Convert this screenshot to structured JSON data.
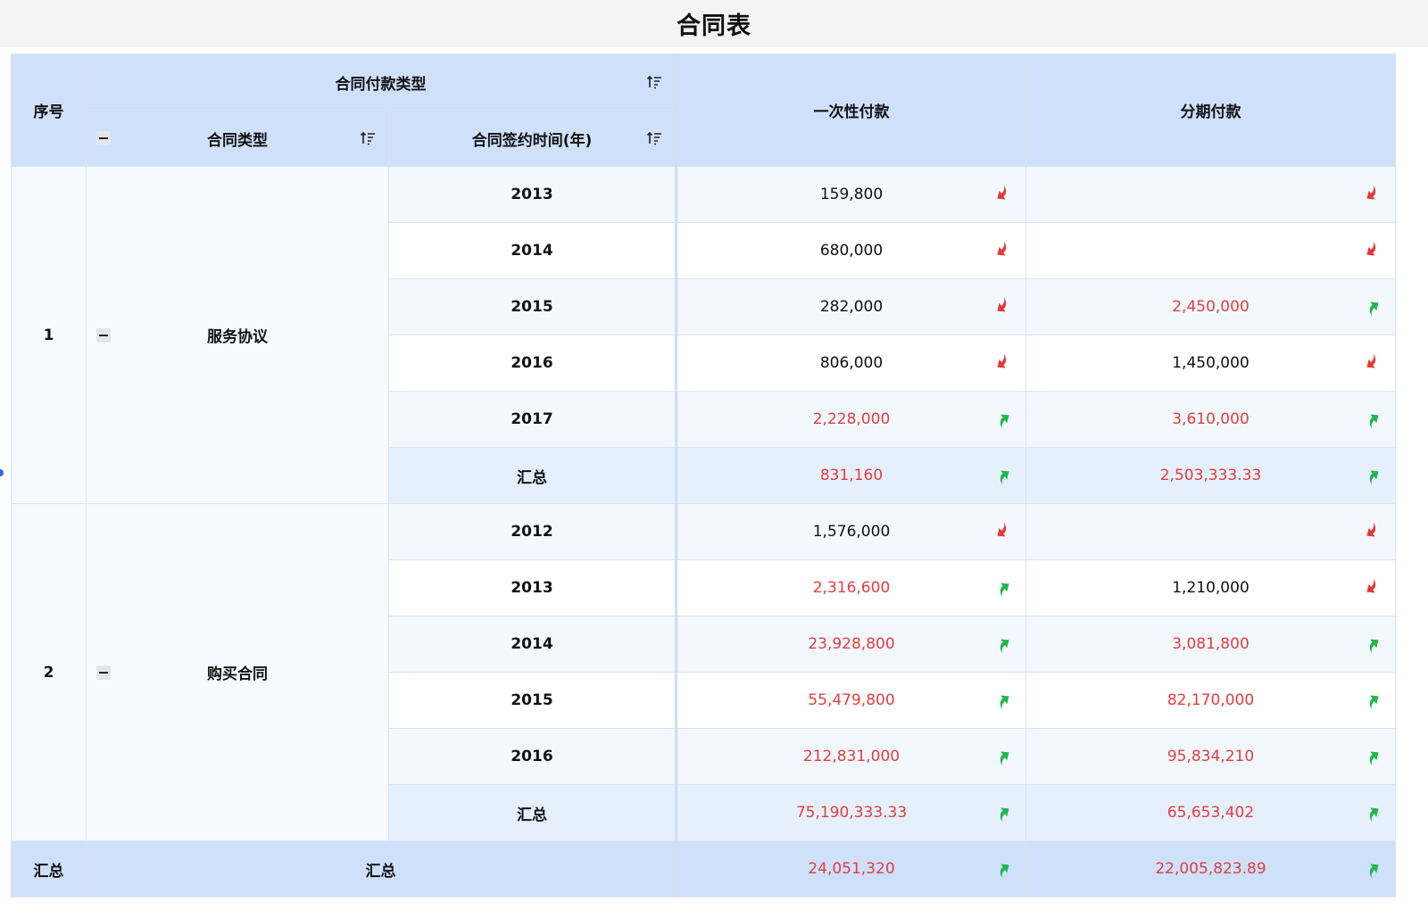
{
  "title": "合同表",
  "headers": {
    "index": "序号",
    "payment_type": "合同付款类型",
    "contract_type": "合同类型",
    "sign_year": "合同签约时间(年)",
    "lump_sum": "一次性付款",
    "installment": "分期付款"
  },
  "groups": [
    {
      "index": "1",
      "name": "服务协议",
      "rows": [
        {
          "year": "2013",
          "lump": "159,800",
          "lump_trend": "down",
          "inst": "",
          "inst_trend": "down"
        },
        {
          "year": "2014",
          "lump": "680,000",
          "lump_trend": "down",
          "inst": "",
          "inst_trend": "down"
        },
        {
          "year": "2015",
          "lump": "282,000",
          "lump_trend": "down",
          "inst": "2,450,000",
          "inst_trend": "up"
        },
        {
          "year": "2016",
          "lump": "806,000",
          "lump_trend": "down",
          "inst": "1,450,000",
          "inst_trend": "down"
        },
        {
          "year": "2017",
          "lump": "2,228,000",
          "lump_trend": "up",
          "inst": "3,610,000",
          "inst_trend": "up"
        },
        {
          "year": "汇总",
          "lump": "831,160",
          "lump_trend": "up",
          "inst": "2,503,333.33",
          "inst_trend": "up",
          "summary": true
        }
      ]
    },
    {
      "index": "2",
      "name": "购买合同",
      "rows": [
        {
          "year": "2012",
          "lump": "1,576,000",
          "lump_trend": "down",
          "inst": "",
          "inst_trend": "down"
        },
        {
          "year": "2013",
          "lump": "2,316,600",
          "lump_trend": "up",
          "inst": "1,210,000",
          "inst_trend": "down"
        },
        {
          "year": "2014",
          "lump": "23,928,800",
          "lump_trend": "up",
          "inst": "3,081,800",
          "inst_trend": "up"
        },
        {
          "year": "2015",
          "lump": "55,479,800",
          "lump_trend": "up",
          "inst": "82,170,000",
          "inst_trend": "up"
        },
        {
          "year": "2016",
          "lump": "212,831,000",
          "lump_trend": "up",
          "inst": "95,834,210",
          "inst_trend": "up"
        },
        {
          "year": "汇总",
          "lump": "75,190,333.33",
          "lump_trend": "up",
          "inst": "65,653,402",
          "inst_trend": "up",
          "summary": true
        }
      ]
    }
  ],
  "grand_total": {
    "index": "汇总",
    "label": "汇总",
    "lump": "24,051,320",
    "lump_trend": "up",
    "inst": "22,005,823.89",
    "inst_trend": "up"
  },
  "colors": {
    "header_bg": "#cfe0fb",
    "up_value": "#e33d3d",
    "up_arrow": "#1fb84a",
    "down_arrow": "#e53935"
  },
  "icons": {
    "sort": "sort-icon",
    "collapse": "collapse-icon",
    "trend_up": "trend-up-arrow-icon",
    "trend_down": "trend-down-arrow-icon"
  }
}
